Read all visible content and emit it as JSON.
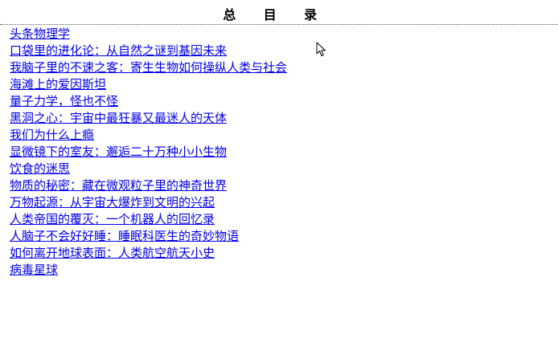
{
  "toc": {
    "title": "总 目 录",
    "items": [
      {
        "label": "头条物理学"
      },
      {
        "label": "口袋里的进化论：从自然之谜到基因未来"
      },
      {
        "label": "我脑子里的不速之客：寄生生物如何操纵人类与社会"
      },
      {
        "label": "海滩上的爱因斯坦"
      },
      {
        "label": "量子力学，怪也不怪"
      },
      {
        "label": "黑洞之心：宇宙中最狂暴又最迷人的天体"
      },
      {
        "label": "我们为什么上瘾"
      },
      {
        "label": "显微镜下的室友：邂逅二十万种小小生物"
      },
      {
        "label": "饮食的迷思"
      },
      {
        "label": "物质的秘密：藏在微观粒子里的神奇世界"
      },
      {
        "label": "万物起源：从宇宙大爆炸到文明的兴起"
      },
      {
        "label": "人类帝国的覆灭：一个机器人的回忆录"
      },
      {
        "label": "人脑子不会好好睡：睡眠科医生的奇妙物语"
      },
      {
        "label": "如何离开地球表面：人类航空航天小史"
      },
      {
        "label": "病毒星球"
      }
    ]
  },
  "cursor": {
    "icon": "mouse-pointer-icon"
  }
}
